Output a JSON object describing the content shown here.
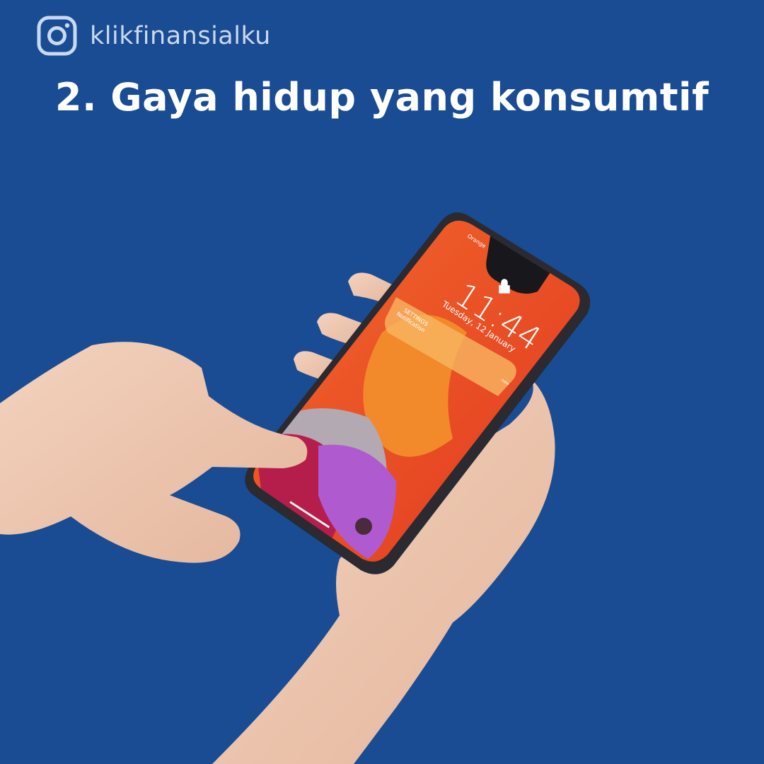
{
  "header": {
    "icon": "instagram-icon",
    "handle": "klikfinansialku"
  },
  "title": "2. Gaya hidup yang konsumtif",
  "phone": {
    "carrier": "Orange",
    "time": "11:44",
    "date": "Tuesday, 12 January",
    "notification": {
      "app": "SETTINGS",
      "text": "Notification",
      "when": "now"
    }
  },
  "colors": {
    "background": "#1a4c93",
    "title": "#ffffff",
    "handle": "#c9d9ef"
  }
}
